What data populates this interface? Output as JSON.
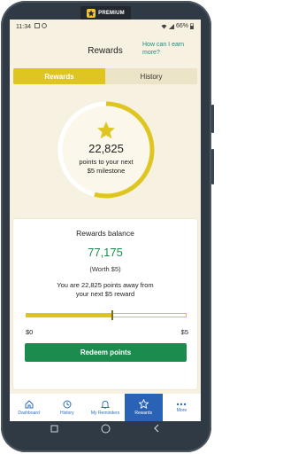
{
  "premium_badge": {
    "label": "PREMIUM",
    "icon": "star-icon"
  },
  "status_bar": {
    "time": "11:34",
    "battery": "66%"
  },
  "header": {
    "title": "Rewards",
    "help_link": "How can I earn more?"
  },
  "tabs": [
    {
      "label": "Rewards",
      "active": true
    },
    {
      "label": "History",
      "active": false
    }
  ],
  "progress_ring": {
    "points": "22,825",
    "caption_line1": "points to your next",
    "caption_line2": "$5 milestone",
    "progress_fraction": 0.54
  },
  "balance_card": {
    "title": "Rewards balance",
    "value": "77,175",
    "worth": "(Worth $5)",
    "away_line1": "You are 22,825 points away from",
    "away_line2": "your next $5 reward",
    "progress_fraction": 0.54,
    "scale_min": "$0",
    "scale_max": "$5",
    "redeem_label": "Redeem points"
  },
  "bottom_nav": [
    {
      "label": "Dashboard",
      "icon": "home-icon",
      "active": false
    },
    {
      "label": "History",
      "icon": "clock-icon",
      "active": false
    },
    {
      "label": "My Reminders",
      "icon": "bell-icon",
      "active": false
    },
    {
      "label": "Rewards",
      "icon": "star-icon",
      "active": true
    },
    {
      "label": "More",
      "icon": "dots-icon",
      "active": false
    }
  ],
  "colors": {
    "accent_gold": "#dfc520",
    "brand_green": "#1c8c4e",
    "nav_blue": "#2a63b5",
    "background": "#f7f1e1"
  }
}
